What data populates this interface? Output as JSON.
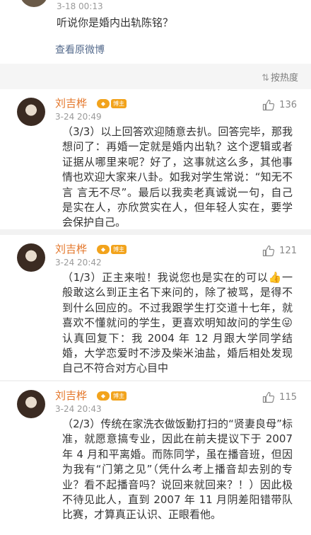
{
  "top_post": {
    "time": "3-18 00:13",
    "text": "听说你是婚内出轨陈铭？",
    "view_original": "查看原微博"
  },
  "sort": {
    "label": "按热度",
    "icon": "sort-icon"
  },
  "comments": [
    {
      "name": "刘吉桦",
      "badge": "博主",
      "time": "3-24 20:49",
      "likes": "136",
      "text": "（3/3）以上回答欢迎随意去扒。回答完毕，那我想问了：再婚一定就是婚内出轨？这个逻辑或者证据从哪里来呢？好了，这事就这么多，其他事情也欢迎大家来八卦。如我对学生常说：“知无不言 言无不尽”。最后以我卖老真诚说一句，自己是实在人，亦欣赏实在人，但年轻人实在，要学会保护自己。"
    },
    {
      "name": "刘吉桦",
      "badge": "博主",
      "time": "3-24 20:42",
      "likes": "121",
      "text": "（1/3）正主来啦！我说您也是实在的可以👍一般敢这么到正主名下来问的，除了被骂，是得不到什么回应的。不过我跟学生打交道十七年，就喜欢不懂就问的学生，更喜欢明知故问的学生😜认真回复下：我 2004 年 12 月跟大学同学结婚，大学恋爱时不涉及柴米油盐，婚后相处发现自己不符合对方心目中"
    },
    {
      "name": "刘吉桦",
      "badge": "博主",
      "time": "3-24 20:43",
      "likes": "115",
      "text": "（2/3）传统在家洗衣做饭勤打扫的“贤妻良母”标准，就愿意搞专业，因此在前夫提议下于 2007 年 4 月和平离婚。而陈同学，虽在播音班，但因为我有“门第之见”（凭什么考上播音却去别的专业？看不起播音吗？说回来就回来？！）因此极不待见此人，直到 2007 年 11 月阴差阳错带队比赛，才算真正认识、正眼看他。"
    }
  ],
  "colors": {
    "name": "#e4772b",
    "badge": "#f2a31c",
    "link": "#556b8d",
    "separator": "#f2f2f2",
    "meta": "#9a9a9a"
  }
}
